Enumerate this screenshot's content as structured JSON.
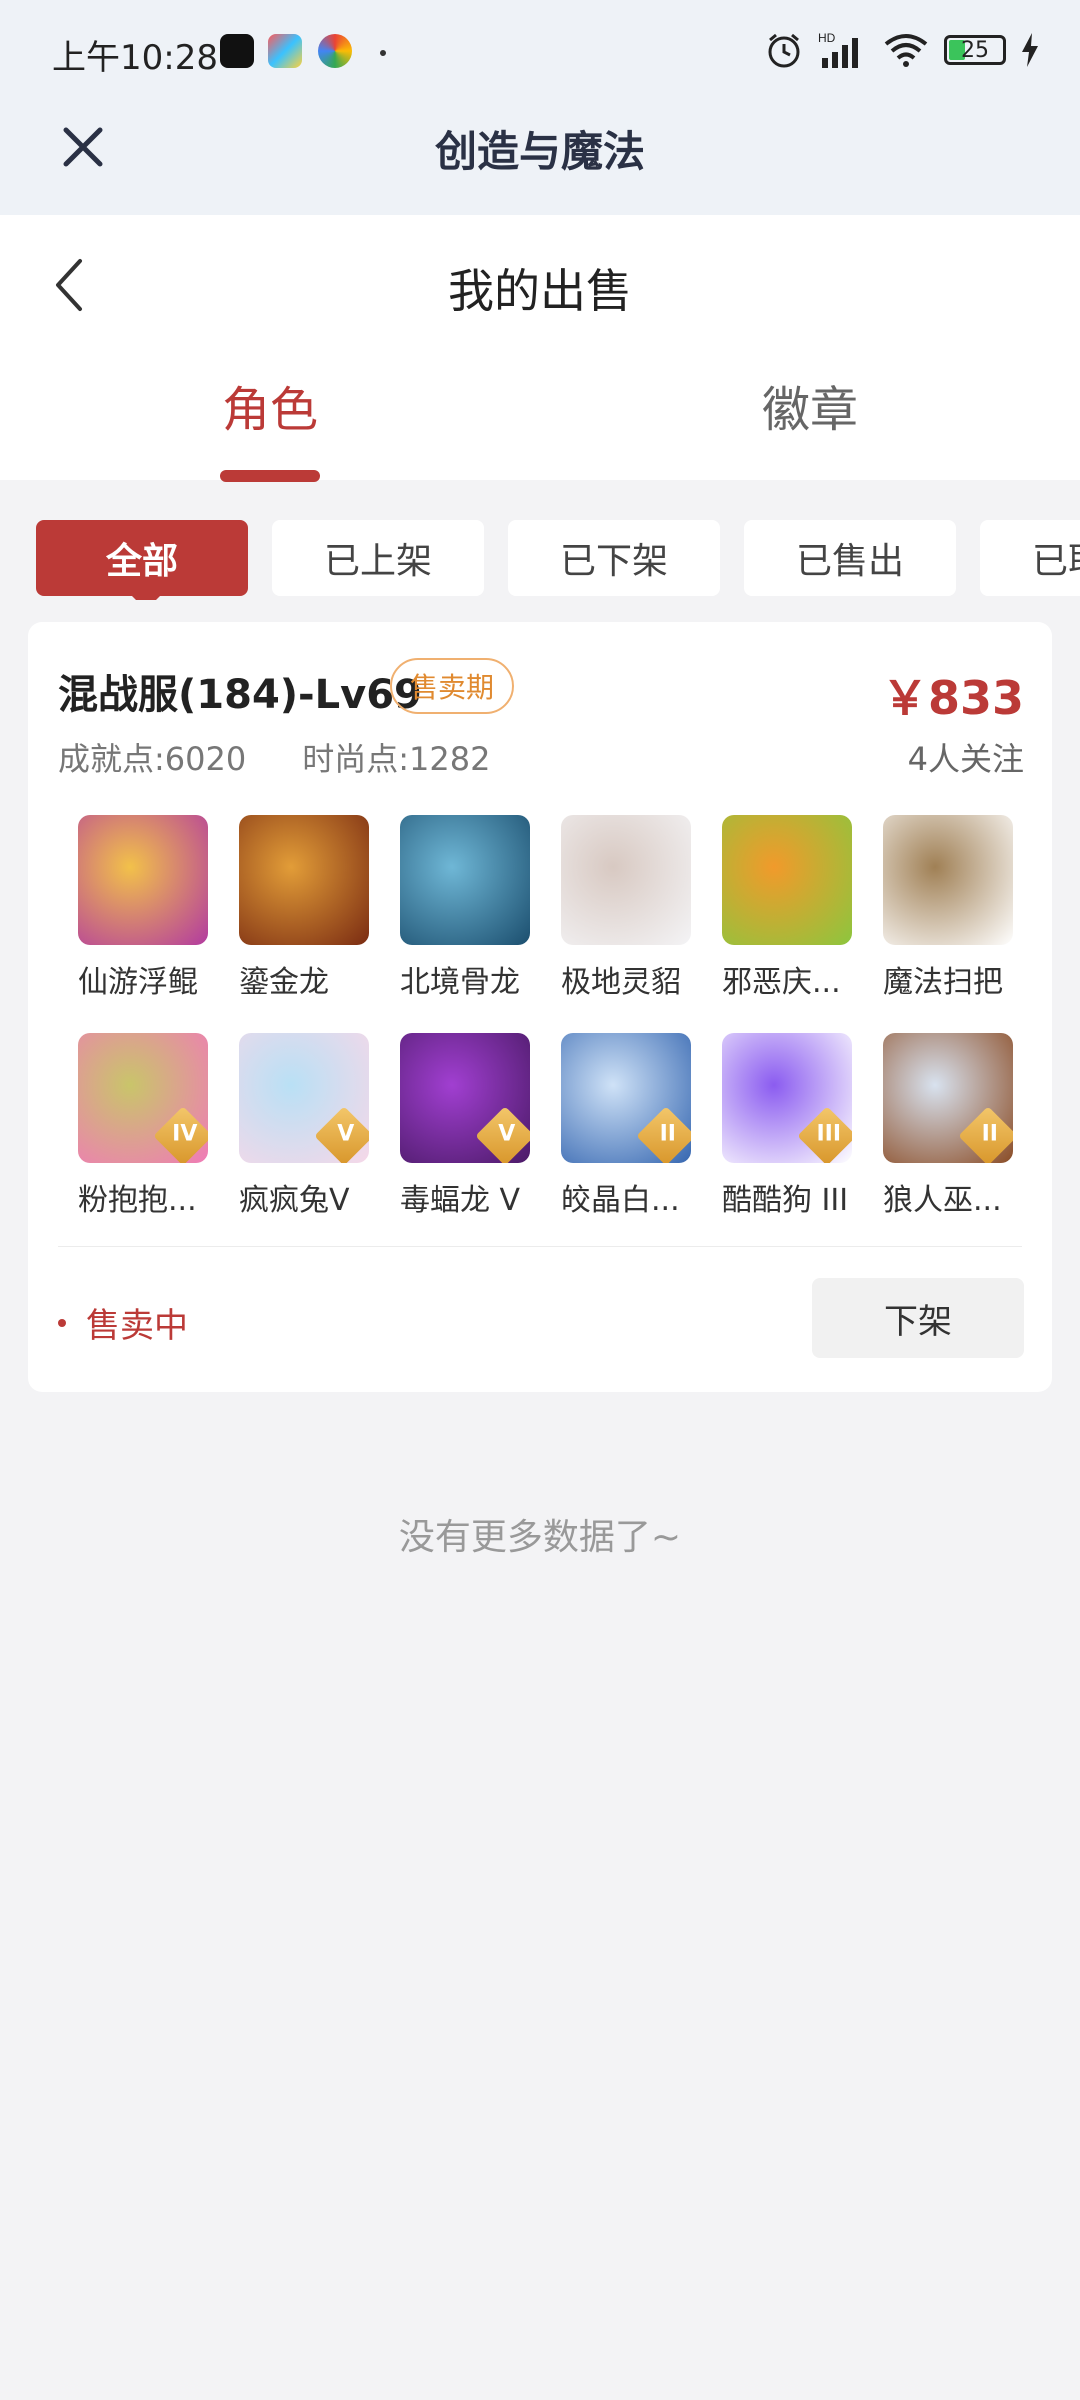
{
  "status_bar": {
    "time": "上午10:28",
    "battery": "25",
    "signal_label": "HD"
  },
  "app_header": {
    "title": "创造与魔法",
    "close_icon": "close-icon"
  },
  "page": {
    "title": "我的出售",
    "back_icon": "chevron-left-icon"
  },
  "tabs": [
    {
      "label": "角色",
      "active": true
    },
    {
      "label": "徽章",
      "active": false
    }
  ],
  "filters": [
    "全部",
    "已上架",
    "已下架",
    "已售出",
    "已取消"
  ],
  "listing": {
    "name": "混战服(184)-Lv69",
    "badge": "售卖期",
    "price": "￥833",
    "achievement": "成就点:6020",
    "fashion": "时尚点:1282",
    "followers": "4人关注",
    "items": [
      {
        "label": "仙游浮鲲",
        "color1": "#b23aa0",
        "color2": "#f2c14a",
        "tier": ""
      },
      {
        "label": "鎏金龙",
        "color1": "#7a2b12",
        "color2": "#e29d38",
        "tier": ""
      },
      {
        "label": "北境骨龙",
        "color1": "#1b4e6e",
        "color2": "#6fb7d6",
        "tier": ""
      },
      {
        "label": "极地灵貂",
        "color1": "#f4f4f6",
        "color2": "#d8c9c2",
        "tier": ""
      },
      {
        "label": "邪恶庆...",
        "color1": "#8cc63e",
        "color2": "#f19a2b",
        "tier": ""
      },
      {
        "label": "魔法扫把",
        "color1": "#ffffff",
        "color2": "#a08055",
        "tier": ""
      },
      {
        "label": "粉抱抱...",
        "color1": "#f07ab8",
        "color2": "#c9c56a",
        "tier": "IV"
      },
      {
        "label": "疯疯兔V",
        "color1": "#f6d8e8",
        "color2": "#b9e0f5",
        "tier": "V"
      },
      {
        "label": "毒蝠龙 V",
        "color1": "#4a1a66",
        "color2": "#a13fd1",
        "tier": "V"
      },
      {
        "label": "皎晶白...",
        "color1": "#3566b0",
        "color2": "#cfe2f7",
        "tier": "II"
      },
      {
        "label": "酷酷狗 III",
        "color1": "#ffffff",
        "color2": "#8b5cf0",
        "tier": "III"
      },
      {
        "label": "狼人巫...",
        "color1": "#8a4b24",
        "color2": "#d8e2ef",
        "tier": "II"
      }
    ],
    "sale_status": "售卖中",
    "action_button": "下架"
  },
  "footer_text": "没有更多数据了~"
}
